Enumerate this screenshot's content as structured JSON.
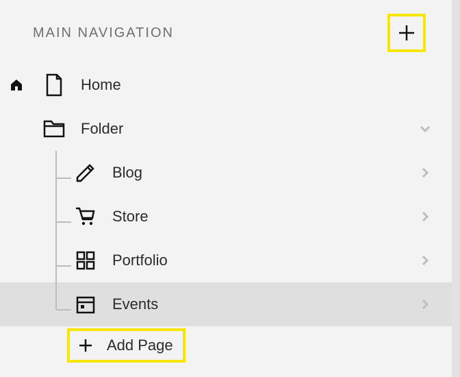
{
  "header": {
    "title": "MAIN NAVIGATION"
  },
  "nav": {
    "home_label": "Home",
    "folder_label": "Folder",
    "children": [
      {
        "label": "Blog"
      },
      {
        "label": "Store"
      },
      {
        "label": "Portfolio"
      },
      {
        "label": "Events"
      }
    ],
    "add_page_label": "Add Page"
  },
  "colors": {
    "highlight": "#f7e600",
    "text": "#2b2b2b",
    "muted": "#6f6f6f",
    "selected_bg": "#dfdfdf"
  }
}
